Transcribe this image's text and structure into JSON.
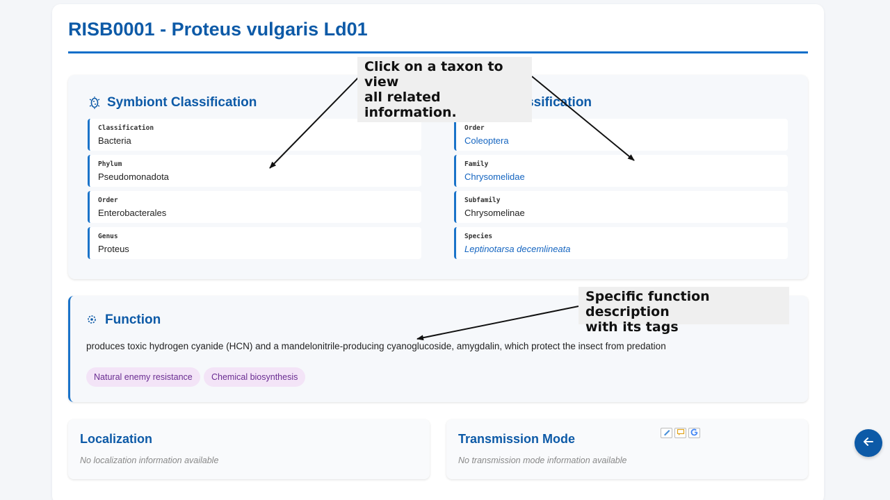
{
  "page": {
    "title": "RISB0001 - Proteus vulgaris Ld01"
  },
  "symbiont": {
    "heading": "Symbiont Classification",
    "icon": "bacteria-icon",
    "fields": [
      {
        "label": "Classification",
        "value": "Bacteria"
      },
      {
        "label": "Phylum",
        "value": "Pseudomonadota"
      },
      {
        "label": "Order",
        "value": "Enterobacterales"
      },
      {
        "label": "Genus",
        "value": "Proteus"
      }
    ]
  },
  "host": {
    "heading": "Host Classification",
    "icon": "bug-icon",
    "fields": [
      {
        "label": "Order",
        "value": "Coleoptera"
      },
      {
        "label": "Family",
        "value": "Chrysomelidae"
      },
      {
        "label": "Subfamily",
        "value": "Chrysomelinae"
      },
      {
        "label": "Species",
        "value": "Leptinotarsa decemlineata"
      }
    ]
  },
  "function": {
    "heading": "Function",
    "icon": "gear-icon",
    "description": "produces toxic hydrogen cyanide (HCN) and a mandelonitrile-producing cyanoglucoside, amygdalin, which protect the insect from predation",
    "tags": [
      "Natural enemy resistance",
      "Chemical biosynthesis"
    ]
  },
  "localization": {
    "heading": "Localization",
    "empty": "No localization information available"
  },
  "transmission": {
    "heading": "Transmission Mode",
    "empty": "No transmission mode information available"
  },
  "annotations": {
    "taxon_line1": "Click on a taxon to view",
    "taxon_line2": "all related information.",
    "function_line1": "Specific function description",
    "function_line2": "with its tags"
  },
  "colors": {
    "accent": "#0d5aa7",
    "link": "#1565c0",
    "tag_bg": "#f3e4f7",
    "tag_text": "#6a2c91"
  },
  "back_button": {
    "icon": "arrow-left-icon"
  }
}
